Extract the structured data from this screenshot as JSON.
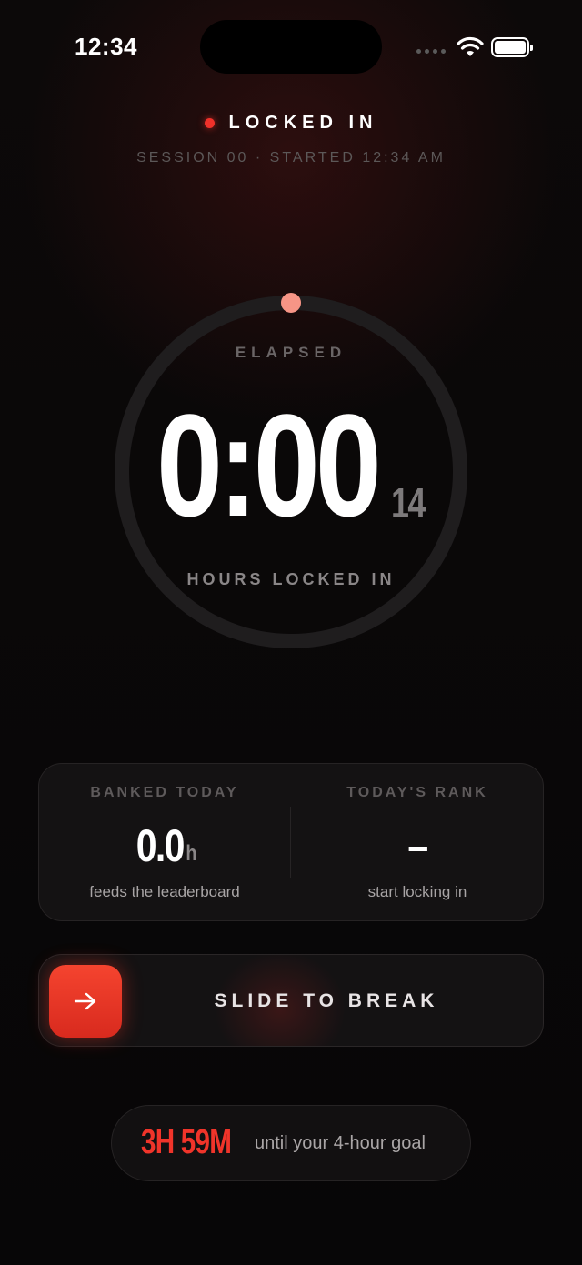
{
  "status_bar": {
    "time": "12:34"
  },
  "header": {
    "status": "LOCKED IN",
    "session_info": "SESSION 00 · STARTED 12:34 AM"
  },
  "timer": {
    "label": "ELAPSED",
    "value": "0:00",
    "seconds": "14",
    "unit_label": "HOURS LOCKED IN",
    "progress_fraction": 0.0
  },
  "stats": {
    "banked": {
      "label": "BANKED TODAY",
      "value": "0.0",
      "unit": "h",
      "sub": "feeds the leaderboard"
    },
    "rank": {
      "label": "TODAY'S RANK",
      "value": "–",
      "sub": "start locking in"
    }
  },
  "slider": {
    "label": "SLIDE TO BREAK",
    "icon": "arrow-right-icon"
  },
  "goal": {
    "remaining": "3H 59M",
    "text": "until your 4-hour goal"
  },
  "colors": {
    "accent": "#f0342a",
    "background": "#0a0809",
    "ring_track": "#1f1d1e",
    "ring_dot": "#f79586"
  }
}
